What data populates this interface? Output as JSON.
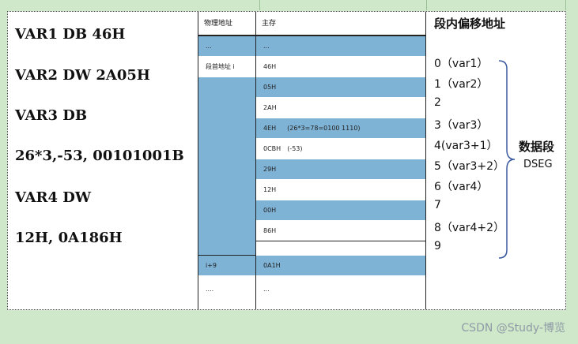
{
  "code": {
    "lines": [
      "VAR1  DB  46H",
      "VAR2  DW  2A05H",
      "VAR3  DB",
      "26*3,-53,  00101001B",
      "VAR4  DW",
      "12H,  0A186H"
    ]
  },
  "table": {
    "headers": [
      "物理地址",
      "主存"
    ],
    "rows": [
      {
        "addr": "...",
        "mem": "...",
        "color": "blue"
      },
      {
        "addr": "段首地址 i",
        "mem": "46H",
        "color": "white"
      },
      {
        "addr": "",
        "mem": "05H",
        "color": "blue"
      },
      {
        "addr": "",
        "mem": "2AH",
        "color": "white"
      },
      {
        "addr": "",
        "mem": "4EH",
        "note": "(26*3=78=0100 1110)",
        "color": "blue"
      },
      {
        "addr": "",
        "mem": "0CBH",
        "note": "(-53)",
        "color": "white"
      },
      {
        "addr": "",
        "mem": "29H",
        "color": "blue"
      },
      {
        "addr": "",
        "mem": "12H",
        "color": "white"
      },
      {
        "addr": "",
        "mem": "00H",
        "color": "blue"
      },
      {
        "addr": "",
        "mem": "86H",
        "color": "white"
      },
      {
        "addr": "i+9",
        "mem": "0A1H",
        "color": "blue"
      },
      {
        "addr": "....",
        "mem": "...",
        "color": "white"
      }
    ]
  },
  "offsets": {
    "title": "段内偏移地址",
    "items": [
      "0（var1）",
      "1（var2）",
      "2",
      "3（var3）",
      "4(var3+1）",
      "5（var3+2）",
      "6（var4）",
      "7",
      "8（var4+2）",
      "9"
    ],
    "segment_label": "数据段",
    "segment_name": "DSEG"
  },
  "watermark": "CSDN @Study-博览",
  "colors": {
    "blue_cell": "#7fb3d6",
    "background": "#cfe8c9",
    "brace": "#3b5aa0"
  }
}
